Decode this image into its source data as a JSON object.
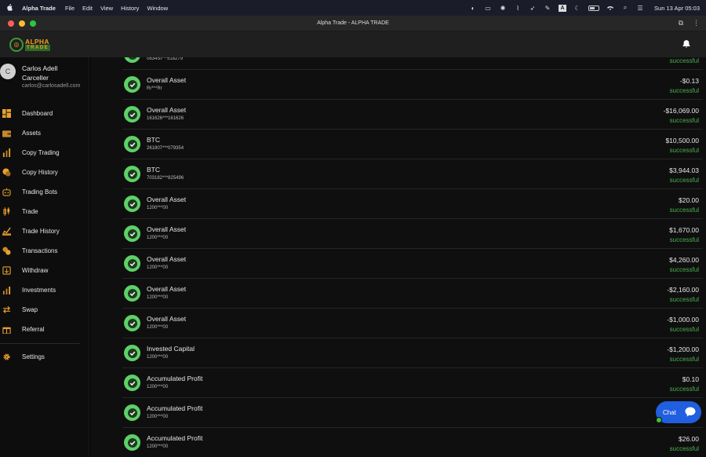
{
  "menubar": {
    "app_name": "Alpha Trade",
    "menus": [
      "File",
      "Edit",
      "View",
      "History",
      "Window"
    ],
    "clock": "Sun 13 Apr  05:03"
  },
  "window": {
    "title": "Alpha Trade - ALPHA TRADE"
  },
  "header": {
    "logo_line1": "ALPHA",
    "logo_line2": "TRADE"
  },
  "user": {
    "initial": "C",
    "name": "Carlos Adell Carceller",
    "email": "carlos@carlosadell.com"
  },
  "nav": {
    "items": [
      {
        "label": "Dashboard",
        "icon": "dashboard-icon"
      },
      {
        "label": "Assets",
        "icon": "wallet-icon"
      },
      {
        "label": "Copy Trading",
        "icon": "copy-trading-icon"
      },
      {
        "label": "Copy History",
        "icon": "copy-history-icon"
      },
      {
        "label": "Trading Bots",
        "icon": "robot-icon"
      },
      {
        "label": "Trade",
        "icon": "candlestick-icon"
      },
      {
        "label": "Trade History",
        "icon": "trade-history-icon"
      },
      {
        "label": "Transactions",
        "icon": "transactions-icon"
      },
      {
        "label": "Withdraw",
        "icon": "withdraw-icon"
      },
      {
        "label": "Investments",
        "icon": "investments-icon"
      },
      {
        "label": "Swap",
        "icon": "swap-icon"
      },
      {
        "label": "Referral",
        "icon": "gift-icon"
      }
    ],
    "settings_label": "Settings"
  },
  "transactions": [
    {
      "title": "",
      "sub": "0634SI***518279",
      "amount": "",
      "status": "successful"
    },
    {
      "title": "Overall Asset",
      "sub": "Rr***Rr",
      "amount": "-$0.13",
      "status": "successful"
    },
    {
      "title": "Overall Asset",
      "sub": "161626***161626",
      "amount": "-$16,069.00",
      "status": "successful"
    },
    {
      "title": "BTC",
      "sub": "261807***079354",
      "amount": "$10,500.00",
      "status": "successful"
    },
    {
      "title": "BTC",
      "sub": "703182***825496",
      "amount": "$3,944.03",
      "status": "successful"
    },
    {
      "title": "Overall Asset",
      "sub": "1200***00",
      "amount": "$20.00",
      "status": "successful"
    },
    {
      "title": "Overall Asset",
      "sub": "1200***00",
      "amount": "$1,670.00",
      "status": "successful"
    },
    {
      "title": "Overall Asset",
      "sub": "1200***00",
      "amount": "$4,260.00",
      "status": "successful"
    },
    {
      "title": "Overall Asset",
      "sub": "1200***00",
      "amount": "-$2,160.00",
      "status": "successful"
    },
    {
      "title": "Overall Asset",
      "sub": "1200***00",
      "amount": "-$1,000.00",
      "status": "successful"
    },
    {
      "title": "Invested Capital",
      "sub": "1200***00",
      "amount": "-$1,200.00",
      "status": "successful"
    },
    {
      "title": "Accumulated Profit",
      "sub": "1200***00",
      "amount": "$0.10",
      "status": "successful"
    },
    {
      "title": "Accumulated Profit",
      "sub": "1200***00",
      "amount": "",
      "status": ""
    },
    {
      "title": "Accumulated Profit",
      "sub": "1200***00",
      "amount": "$26.00",
      "status": "successful"
    }
  ],
  "chat": {
    "label": "Chat"
  },
  "colors": {
    "success": "#4caf50",
    "check_bg": "#5fd068",
    "chat_bg": "#1f5fe0",
    "brand_orange": "#f0a020"
  }
}
